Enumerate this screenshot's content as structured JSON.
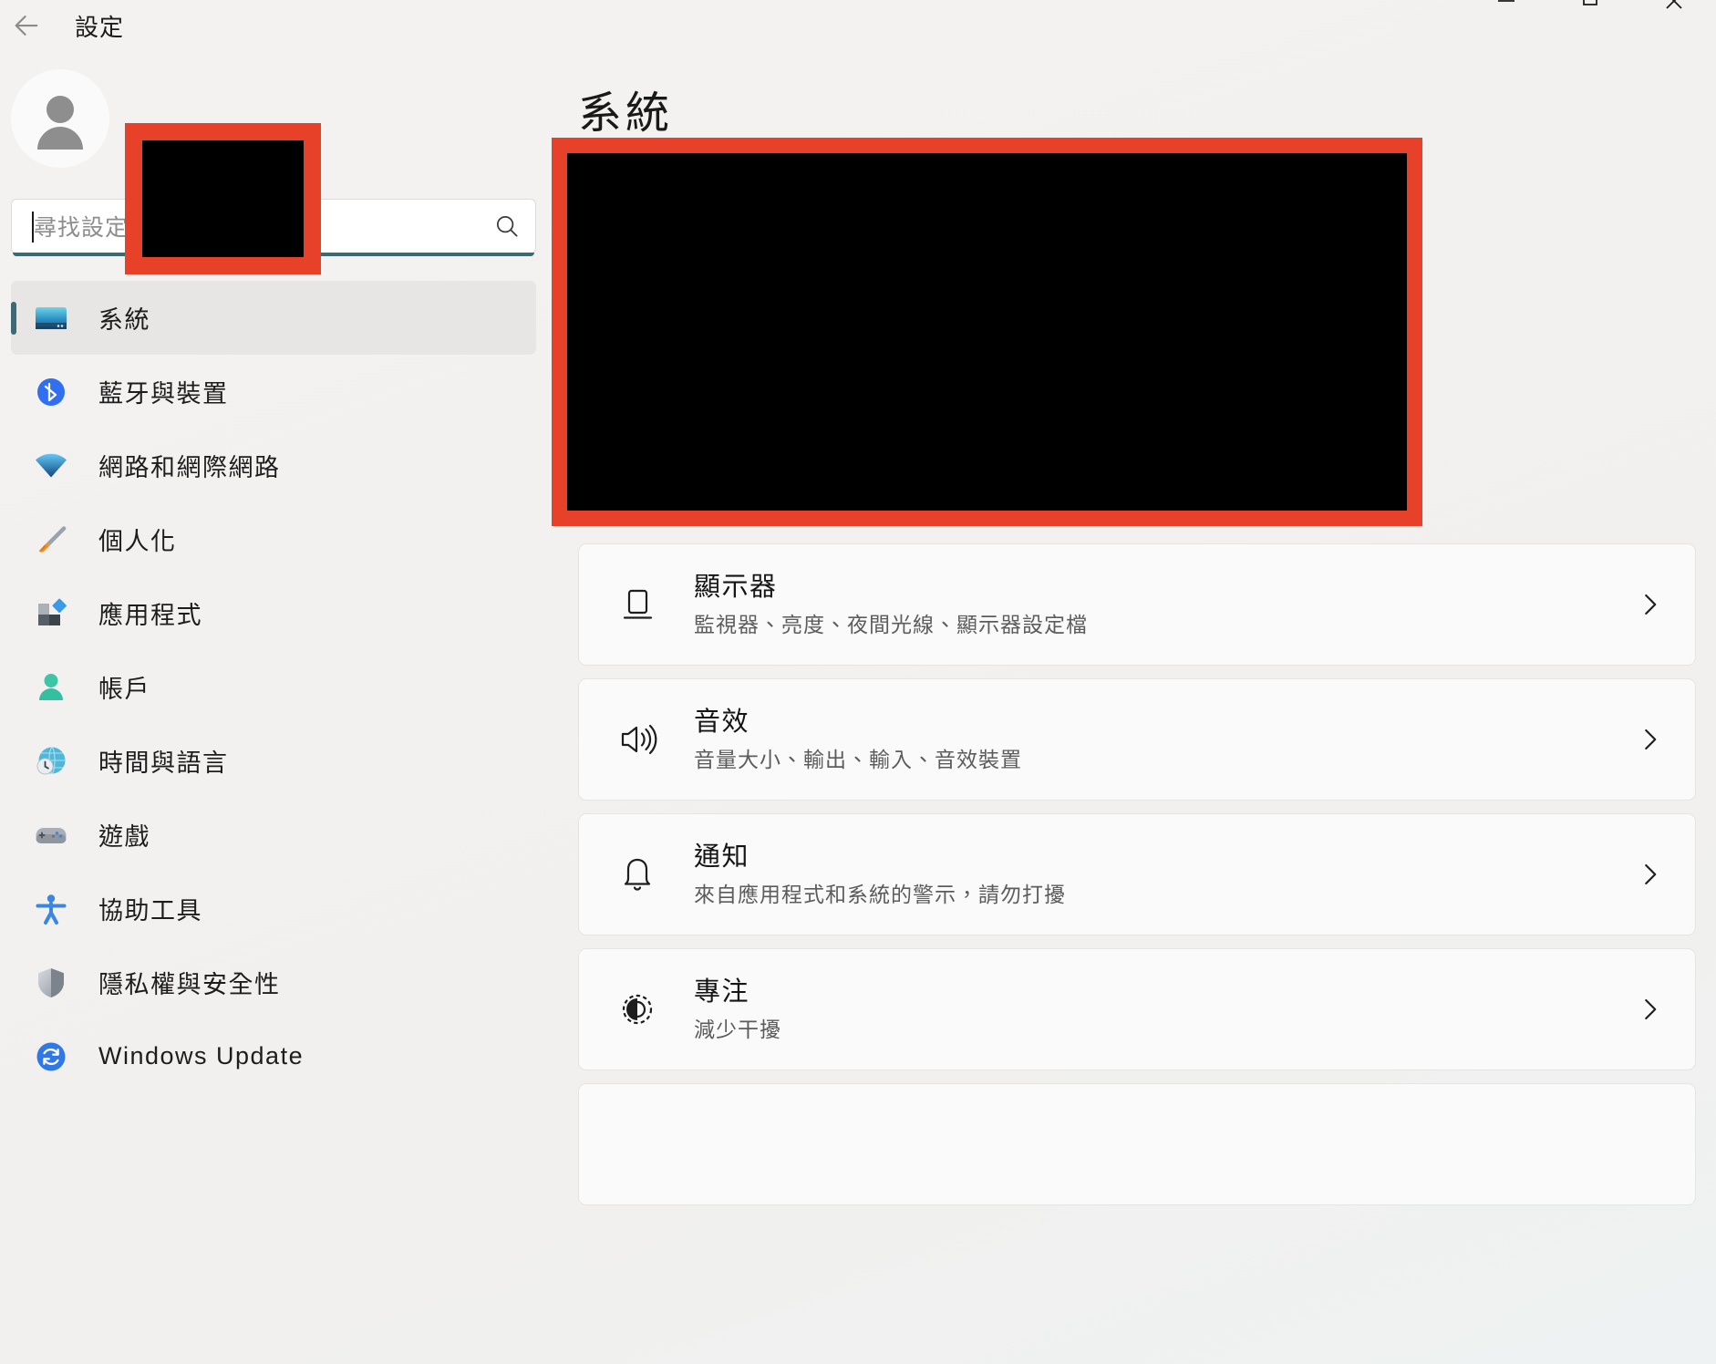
{
  "window": {
    "app_title": "設定",
    "back_icon": "back-arrow-icon",
    "controls": [
      {
        "name": "minimize",
        "glyph": "minimize-icon"
      },
      {
        "name": "maximize",
        "glyph": "maximize-icon"
      },
      {
        "name": "close",
        "glyph": "close-icon"
      }
    ]
  },
  "accent": {
    "redaction_border": "#e8412a",
    "redaction_fill": "#000000",
    "selection_pill": "#3d6a72",
    "search_focus_underline": "#3a6a72",
    "sidebar_selected_bg": "#e8e6e5",
    "page_bg": "#f3f1f1"
  },
  "sidebar": {
    "avatar_icon": "user-avatar-icon",
    "search": {
      "placeholder": "尋找設定",
      "icon": "search-icon",
      "value": ""
    },
    "items": [
      {
        "label": "系統",
        "icon": "system-monitor-icon",
        "selected": true
      },
      {
        "label": "藍牙與裝置",
        "icon": "bluetooth-icon",
        "selected": false
      },
      {
        "label": "網路和網際網路",
        "icon": "wifi-icon",
        "selected": false
      },
      {
        "label": "個人化",
        "icon": "paintbrush-icon",
        "selected": false
      },
      {
        "label": "應用程式",
        "icon": "apps-icon",
        "selected": false
      },
      {
        "label": "帳戶",
        "icon": "account-person-icon",
        "selected": false
      },
      {
        "label": "時間與語言",
        "icon": "clock-globe-icon",
        "selected": false
      },
      {
        "label": "遊戲",
        "icon": "gamepad-icon",
        "selected": false
      },
      {
        "label": "協助工具",
        "icon": "accessibility-icon",
        "selected": false
      },
      {
        "label": "隱私權與安全性",
        "icon": "shield-icon",
        "selected": false
      },
      {
        "label": "Windows Update",
        "icon": "update-refresh-icon",
        "selected": false
      }
    ]
  },
  "main": {
    "page_title": "系統",
    "cards": [
      {
        "title": "顯示器",
        "subtitle": "監視器、亮度、夜間光線、顯示器設定檔",
        "icon": "display-monitor-icon",
        "chevron": "chevron-right-icon"
      },
      {
        "title": "音效",
        "subtitle": "音量大小、輸出、輸入、音效裝置",
        "icon": "speaker-volume-icon",
        "chevron": "chevron-right-icon"
      },
      {
        "title": "通知",
        "subtitle": "來自應用程式和系統的警示，請勿打擾",
        "icon": "bell-icon",
        "chevron": "chevron-right-icon"
      },
      {
        "title": "專注",
        "subtitle": "減少干擾",
        "icon": "focus-target-icon",
        "chevron": "chevron-right-icon"
      }
    ]
  }
}
